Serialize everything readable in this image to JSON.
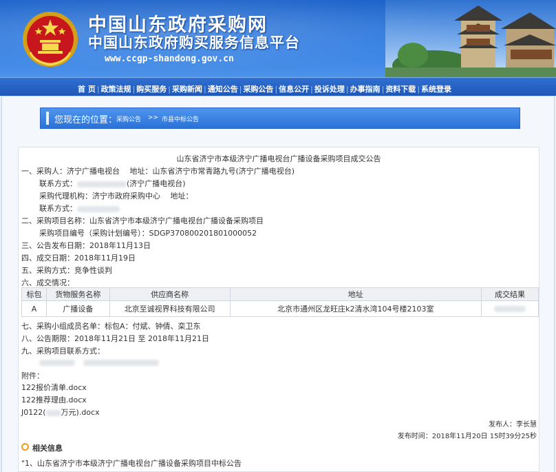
{
  "header": {
    "site_title": "中国山东政府采购网",
    "site_subtitle": "中国山东政府购买服务信息平台",
    "site_url": "www.ccgp-shandong.gov.cn",
    "emblem_icon": "national-emblem-icon",
    "banner_color": "#2a72d8"
  },
  "nav": {
    "items": [
      "首 页",
      "政策法规",
      "购买服务",
      "采购新闻",
      "通知公告",
      "采购公告",
      "信息公开",
      "投诉处理",
      "办事指南",
      "资料下载",
      "系统登录"
    ],
    "separator": "|"
  },
  "location": {
    "label": "您现在的位置：",
    "crumb1": "采购公告",
    "arrow": ">>",
    "crumb2": "市县中标公告"
  },
  "notice": {
    "title": "山东省济宁市本级济宁广播电视台广播设备采购项目成交公告",
    "purchaser_line": "一、采购人：济宁广播电视台　 地址：山东省济宁市常青路九号(济宁广播电视台)",
    "contact_label": "联系方式：",
    "contact_suffix": "(济宁广播电视台)",
    "agency_line": "采购代理机构：济宁市政府采购中心　 地址：",
    "agency_contact_label": "联系方式：",
    "project_name_line": "二、采购项目名称：山东省济宁市本级济宁广播电视台广播设备采购项目",
    "project_no_line": "采购项目编号（采购计划编号）：SDGP370800201801000052",
    "publish_date_line": "三、公告发布日期：2018年11月13日",
    "deal_date_line": "四、成交日期：2018年11月19日",
    "method_line": "五、采购方式：竞争性谈判",
    "result_heading": "六、成交情况：",
    "table": {
      "headers": [
        "标包",
        "货物服务名称",
        "供应商名称",
        "地址",
        "成交结果"
      ],
      "rows": [
        [
          "A",
          "广播设备",
          "北京至诚视界科技有限公司",
          "北京市通州区龙旺庄k2清水湾104号楼2103室",
          ""
        ]
      ]
    },
    "panel_line": "七、采购小组成员名单：标包A：付斌、钟倩、栾卫东",
    "period_line": "八、公告期限：2018年11月21日 至 2018年11月21日",
    "project_contact_line": "九、采购项目联系方式：",
    "attachments_label": "附件：",
    "attachments": [
      "122报价清单.docx",
      "122推荐理由.docx"
    ],
    "attachment3_prefix": "J0122(",
    "attachment3_suffix": "万元).docx",
    "publisher": "发布人：李长慧",
    "publish_time": "发布时间：2018年11月20日 15时39分25秒"
  },
  "related": {
    "title": "相关信息",
    "item": "\"1、山东省济宁市本级济宁广播电视台广播设备采购项目中标公告"
  }
}
